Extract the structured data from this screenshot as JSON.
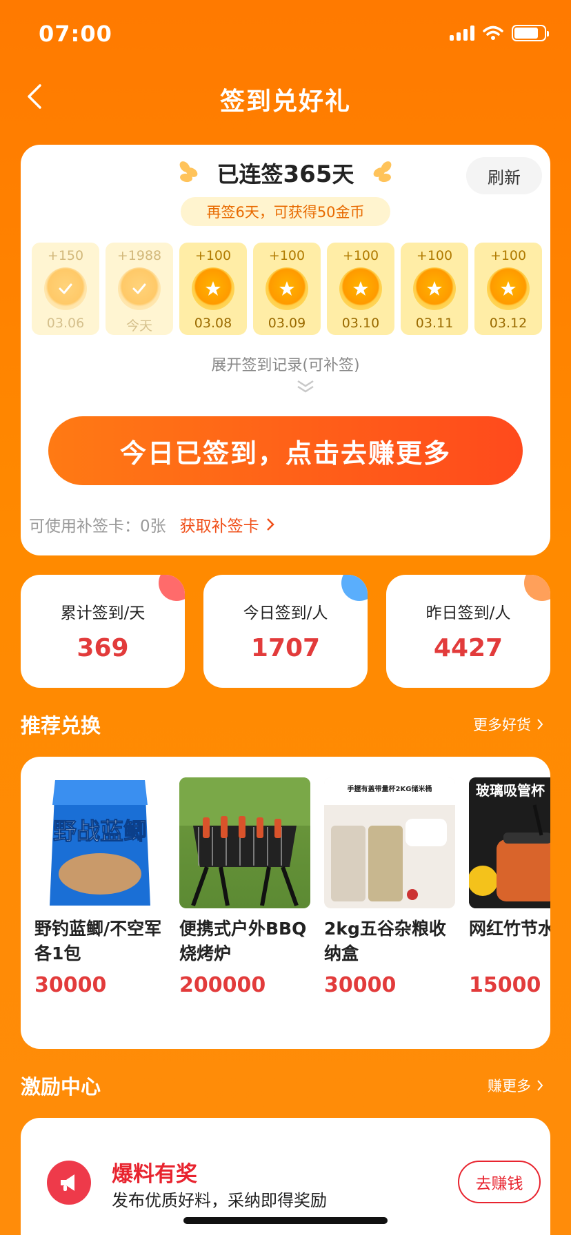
{
  "status_bar": {
    "time": "07:00"
  },
  "nav": {
    "title": "签到兑好礼"
  },
  "signin": {
    "streak_prefix": "已连签",
    "streak_days": "365",
    "streak_suffix": "天",
    "refresh_label": "刷新",
    "bonus_hint": "再签6天，可获得50金币",
    "days": [
      {
        "points": "+150",
        "date": "03.06",
        "state": "signed"
      },
      {
        "points": "+1988",
        "date": "今天",
        "state": "signed"
      },
      {
        "points": "+100",
        "date": "03.08",
        "state": "upcoming"
      },
      {
        "points": "+100",
        "date": "03.09",
        "state": "upcoming"
      },
      {
        "points": "+100",
        "date": "03.10",
        "state": "upcoming"
      },
      {
        "points": "+100",
        "date": "03.11",
        "state": "upcoming"
      },
      {
        "points": "+100",
        "date": "03.12",
        "state": "upcoming"
      }
    ],
    "expand_label": "展开签到记录(可补签)",
    "main_button": "今日已签到，点击去赚更多",
    "makeup_card_label": "可使用补签卡：0张",
    "makeup_card_link": "获取补签卡"
  },
  "stats": [
    {
      "label": "累计签到/天",
      "value": "369",
      "dot_color": "#ff6b6b"
    },
    {
      "label": "今日签到/人",
      "value": "1707",
      "dot_color": "#5aaefc"
    },
    {
      "label": "昨日签到/人",
      "value": "4427",
      "dot_color": "#ffa05a"
    }
  ],
  "recommend": {
    "title": "推荐兑换",
    "more": "更多好货",
    "products": [
      {
        "name": "野钓蓝鲫/不空军各1包",
        "price": "30000",
        "image_text": "野战蓝鲫"
      },
      {
        "name": "便携式户外BBQ烧烤炉",
        "price": "200000",
        "image_text": ""
      },
      {
        "name": "2kg五谷杂粮收纳盒",
        "price": "30000",
        "image_text": "手握有盖带量杯2KG储米桶"
      },
      {
        "name": "网红竹节水",
        "price": "15000",
        "image_text": "玻璃吸管杯"
      }
    ]
  },
  "incentive": {
    "title": "激励中心",
    "more": "赚更多",
    "item_title": "爆料有奖",
    "item_sub": "发布优质好料，采纳即得奖励",
    "item_button": "去赚钱"
  },
  "colors": {
    "brand_orange": "#ff7a00",
    "price_red": "#e23b3b",
    "coin_gold": "#ffa800"
  }
}
